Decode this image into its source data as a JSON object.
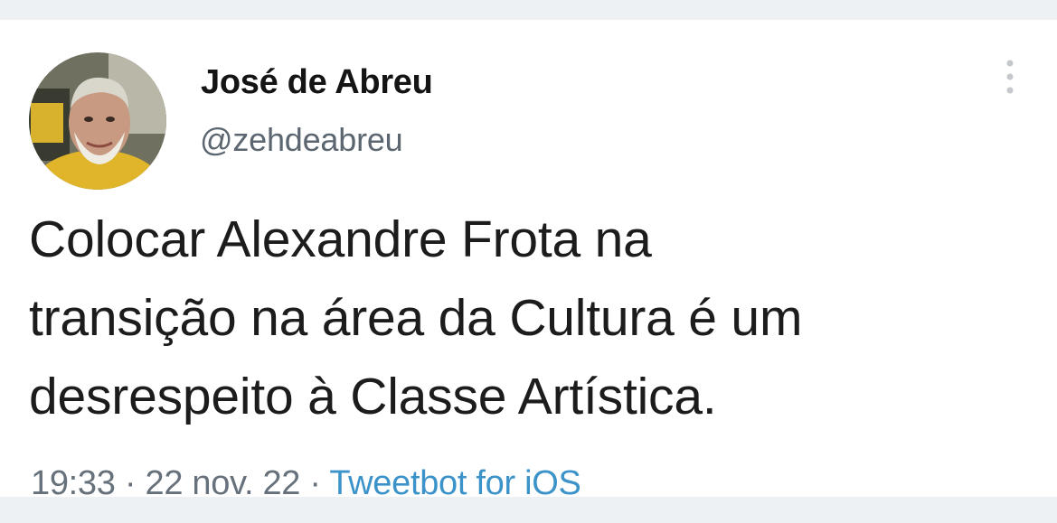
{
  "tweet": {
    "display_name": "José de Abreu",
    "handle": "@zehdeabreu",
    "text_lines": [
      "Colocar Alexandre Frota na",
      "transição na área da Cultura é um",
      "desrespeito à Classe Artística."
    ],
    "time": "19:33",
    "separator": "·",
    "date": "22 nov. 22",
    "source": "Tweetbot for iOS"
  },
  "icons": {
    "avatar": "avatar-photo",
    "more": "more-vertical-icon"
  },
  "colors": {
    "name": "#141414",
    "handle": "#5b6670",
    "body": "#1c1c1c",
    "meta": "#66717b",
    "link": "#3b93c9",
    "background": "#eef1f4",
    "card": "#ffffff"
  }
}
